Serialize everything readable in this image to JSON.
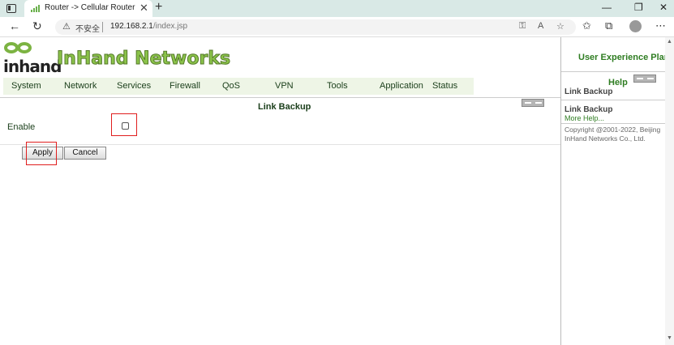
{
  "browser": {
    "tab_title": "Router -> Cellular Router",
    "tab_close": "✕",
    "new_tab": "+",
    "insecure_label": "不安全",
    "url_host": "192.168.2.1",
    "url_path": "/index.jsp"
  },
  "header": {
    "logo_text": "inhand",
    "brand_name": "InHand Networks"
  },
  "menu": [
    "System",
    "Network",
    "Services",
    "Firewall",
    "QoS",
    "VPN",
    "Tools",
    "Application",
    "Status"
  ],
  "section": {
    "title": "Link Backup",
    "enable_label": "Enable",
    "enable_checked": false,
    "apply_label": "Apply",
    "cancel_label": "Cancel"
  },
  "sidebar": {
    "user_experience": "User Experience Plan",
    "help_title": "Help",
    "item1": "Link Backup",
    "item2": "Link Backup",
    "more_help": "More Help...",
    "copyright": "Copyright @2001-2022, Beijing InHand Networks Co., Ltd."
  },
  "colors": {
    "brand_green": "#8bc34a",
    "nav_text": "#1a3e1a",
    "highlight_red": "#e01e1e",
    "help_green": "#2f7d22"
  }
}
